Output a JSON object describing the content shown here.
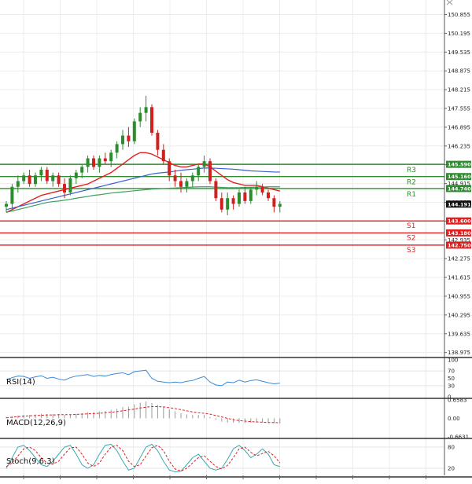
{
  "chart_data": {
    "type": "candlestick",
    "price_axis": {
      "ylim": [
        138.8,
        151.2
      ],
      "ticks": [
        "150.855",
        "150.195",
        "149.535",
        "148.875",
        "148.215",
        "147.555",
        "146.895",
        "146.235",
        "145.575",
        "144.915",
        "144.255",
        "143.595",
        "142.935",
        "142.275",
        "141.615",
        "140.955",
        "140.295",
        "139.635",
        "138.975"
      ],
      "current_price": "144.191",
      "grid": true
    },
    "levels": [
      {
        "name": "R3",
        "value": 145.59,
        "label": "145.590",
        "color": "#2e8b2e"
      },
      {
        "name": "R2",
        "value": 145.16,
        "label": "145.160",
        "color": "#2e8b2e"
      },
      {
        "name": "R1",
        "value": 144.74,
        "label": "144.740",
        "color": "#2e8b2e"
      },
      {
        "name": "S1",
        "value": 143.6,
        "label": "143.600",
        "color": "#e02020"
      },
      {
        "name": "S2",
        "value": 143.18,
        "label": "143.180",
        "color": "#e02020"
      },
      {
        "name": "S3",
        "value": 142.75,
        "label": "142.750",
        "color": "#e02020"
      }
    ],
    "candles": [
      [
        144.1,
        144.3,
        143.9,
        144.2
      ],
      [
        144.2,
        144.9,
        144.0,
        144.8
      ],
      [
        144.8,
        145.2,
        144.6,
        145.0
      ],
      [
        145.0,
        145.3,
        144.9,
        145.2
      ],
      [
        145.2,
        145.4,
        144.8,
        144.9
      ],
      [
        144.9,
        145.3,
        144.8,
        145.2
      ],
      [
        145.2,
        145.5,
        145.0,
        145.4
      ],
      [
        145.4,
        145.5,
        144.9,
        145.0
      ],
      [
        145.0,
        145.3,
        144.8,
        145.2
      ],
      [
        145.2,
        145.3,
        144.8,
        144.9
      ],
      [
        144.9,
        145.1,
        144.4,
        144.6
      ],
      [
        144.6,
        145.2,
        144.5,
        145.1
      ],
      [
        145.1,
        145.4,
        144.9,
        145.3
      ],
      [
        145.3,
        145.6,
        145.1,
        145.5
      ],
      [
        145.5,
        145.9,
        145.3,
        145.8
      ],
      [
        145.8,
        145.9,
        145.4,
        145.5
      ],
      [
        145.5,
        145.9,
        145.3,
        145.8
      ],
      [
        145.8,
        146.0,
        145.6,
        145.7
      ],
      [
        145.7,
        146.1,
        145.5,
        146.0
      ],
      [
        146.0,
        146.4,
        145.8,
        146.3
      ],
      [
        146.3,
        146.8,
        146.1,
        146.6
      ],
      [
        146.6,
        146.9,
        146.2,
        146.4
      ],
      [
        146.4,
        147.2,
        146.3,
        147.1
      ],
      [
        147.1,
        147.6,
        146.9,
        147.4
      ],
      [
        147.4,
        148.0,
        147.1,
        147.6
      ],
      [
        147.6,
        147.7,
        146.6,
        146.7
      ],
      [
        146.7,
        146.8,
        145.9,
        146.1
      ],
      [
        146.1,
        146.3,
        145.6,
        145.7
      ],
      [
        145.7,
        145.8,
        145.0,
        145.2
      ],
      [
        145.2,
        145.4,
        144.8,
        145.0
      ],
      [
        145.0,
        145.3,
        144.6,
        144.8
      ],
      [
        144.8,
        145.1,
        144.6,
        145.0
      ],
      [
        145.0,
        145.3,
        144.8,
        145.2
      ],
      [
        145.2,
        145.6,
        145.0,
        145.5
      ],
      [
        145.5,
        145.9,
        145.3,
        145.7
      ],
      [
        145.7,
        145.8,
        144.9,
        145.0
      ],
      [
        145.0,
        145.1,
        144.3,
        144.4
      ],
      [
        144.4,
        144.6,
        143.9,
        144.0
      ],
      [
        144.0,
        144.6,
        143.8,
        144.4
      ],
      [
        144.4,
        144.5,
        144.0,
        144.2
      ],
      [
        144.2,
        144.7,
        144.1,
        144.6
      ],
      [
        144.6,
        144.8,
        144.2,
        144.3
      ],
      [
        144.3,
        144.8,
        144.2,
        144.7
      ],
      [
        144.7,
        145.0,
        144.5,
        144.8
      ],
      [
        144.8,
        144.9,
        144.5,
        144.6
      ],
      [
        144.6,
        144.7,
        144.3,
        144.4
      ],
      [
        144.4,
        144.5,
        143.9,
        144.1
      ],
      [
        144.1,
        144.3,
        143.9,
        144.2
      ]
    ],
    "moving_averages": {
      "red": [
        143.9,
        144.0,
        144.1,
        144.2,
        144.3,
        144.4,
        144.5,
        144.55,
        144.6,
        144.65,
        144.7,
        144.75,
        144.8,
        144.85,
        144.9,
        145.0,
        145.1,
        145.2,
        145.3,
        145.45,
        145.6,
        145.75,
        145.9,
        146.0,
        146.0,
        145.95,
        145.85,
        145.75,
        145.65,
        145.55,
        145.5,
        145.5,
        145.55,
        145.6,
        145.6,
        145.5,
        145.35,
        145.2,
        145.05,
        144.95,
        144.9,
        144.85,
        144.85,
        144.85,
        144.8,
        144.75,
        144.7,
        144.65
      ],
      "blue": [
        144.0,
        144.05,
        144.1,
        144.15,
        144.2,
        144.25,
        144.3,
        144.35,
        144.4,
        144.45,
        144.5,
        144.55,
        144.6,
        144.65,
        144.7,
        144.75,
        144.8,
        144.85,
        144.9,
        144.95,
        145.0,
        145.05,
        145.1,
        145.15,
        145.2,
        145.25,
        145.28,
        145.3,
        145.32,
        145.35,
        145.38,
        145.4,
        145.42,
        145.44,
        145.46,
        145.46,
        145.45,
        145.44,
        145.43,
        145.42,
        145.4,
        145.38,
        145.36,
        145.35,
        145.34,
        145.33,
        145.32,
        145.32
      ],
      "green": [
        143.9,
        143.95,
        144.0,
        144.05,
        144.1,
        144.15,
        144.2,
        144.25,
        144.28,
        144.3,
        144.33,
        144.36,
        144.4,
        144.43,
        144.46,
        144.5,
        144.52,
        144.55,
        144.58,
        144.6,
        144.62,
        144.64,
        144.66,
        144.68,
        144.7,
        144.72,
        144.73,
        144.74,
        144.75,
        144.76,
        144.77,
        144.78,
        144.79,
        144.8,
        144.8,
        144.8,
        144.79,
        144.78,
        144.77,
        144.77,
        144.77,
        144.78,
        144.78,
        144.79,
        144.79,
        144.8,
        144.8,
        144.8
      ]
    },
    "rsi": {
      "label": "RSI(14)",
      "ticks": [
        "100",
        "70",
        "50",
        "30",
        "0"
      ],
      "values": [
        46,
        52,
        56,
        55,
        50,
        54,
        57,
        50,
        53,
        48,
        45,
        52,
        56,
        58,
        60,
        55,
        58,
        56,
        60,
        63,
        65,
        60,
        68,
        70,
        72,
        50,
        42,
        40,
        38,
        40,
        38,
        42,
        44,
        50,
        55,
        40,
        32,
        30,
        40,
        38,
        45,
        40,
        44,
        46,
        42,
        38,
        35,
        37
      ]
    },
    "macd": {
      "label": "MACD(12,26,9)",
      "ticks": [
        "0.6583",
        "0.00",
        "-0.6631"
      ],
      "histogram": [
        0.05,
        0.08,
        0.1,
        0.12,
        0.12,
        0.14,
        0.16,
        0.15,
        0.15,
        0.14,
        0.12,
        0.14,
        0.16,
        0.18,
        0.22,
        0.22,
        0.25,
        0.26,
        0.3,
        0.34,
        0.4,
        0.42,
        0.5,
        0.56,
        0.6,
        0.55,
        0.48,
        0.4,
        0.32,
        0.25,
        0.18,
        0.14,
        0.12,
        0.12,
        0.12,
        0.05,
        -0.05,
        -0.12,
        -0.15,
        -0.16,
        -0.16,
        -0.17,
        -0.16,
        -0.15,
        -0.15,
        -0.16,
        -0.18,
        -0.18
      ],
      "signal": [
        0.02,
        0.04,
        0.06,
        0.08,
        0.09,
        0.1,
        0.11,
        0.12,
        0.12,
        0.13,
        0.13,
        0.13,
        0.14,
        0.15,
        0.16,
        0.17,
        0.18,
        0.2,
        0.22,
        0.24,
        0.27,
        0.3,
        0.33,
        0.37,
        0.4,
        0.42,
        0.42,
        0.41,
        0.38,
        0.35,
        0.31,
        0.27,
        0.23,
        0.2,
        0.18,
        0.15,
        0.1,
        0.05,
        0.0,
        -0.05,
        -0.08,
        -0.1,
        -0.12,
        -0.13,
        -0.14,
        -0.15,
        -0.15,
        -0.16
      ]
    },
    "stoch": {
      "label": "Stoch(9,6,3)",
      "ticks": [
        "80",
        "20"
      ],
      "k": [
        20,
        50,
        80,
        85,
        70,
        50,
        30,
        25,
        40,
        60,
        80,
        85,
        60,
        30,
        20,
        30,
        60,
        85,
        88,
        70,
        40,
        15,
        20,
        50,
        80,
        88,
        70,
        40,
        15,
        10,
        12,
        30,
        50,
        60,
        40,
        20,
        15,
        20,
        45,
        75,
        85,
        70,
        50,
        60,
        75,
        60,
        30,
        25
      ],
      "d": [
        25,
        35,
        55,
        75,
        80,
        70,
        50,
        35,
        32,
        40,
        60,
        78,
        80,
        60,
        35,
        25,
        35,
        60,
        80,
        85,
        70,
        40,
        25,
        30,
        55,
        78,
        85,
        70,
        40,
        18,
        12,
        20,
        35,
        50,
        55,
        40,
        25,
        18,
        28,
        50,
        75,
        80,
        65,
        55,
        62,
        68,
        55,
        35
      ]
    }
  }
}
